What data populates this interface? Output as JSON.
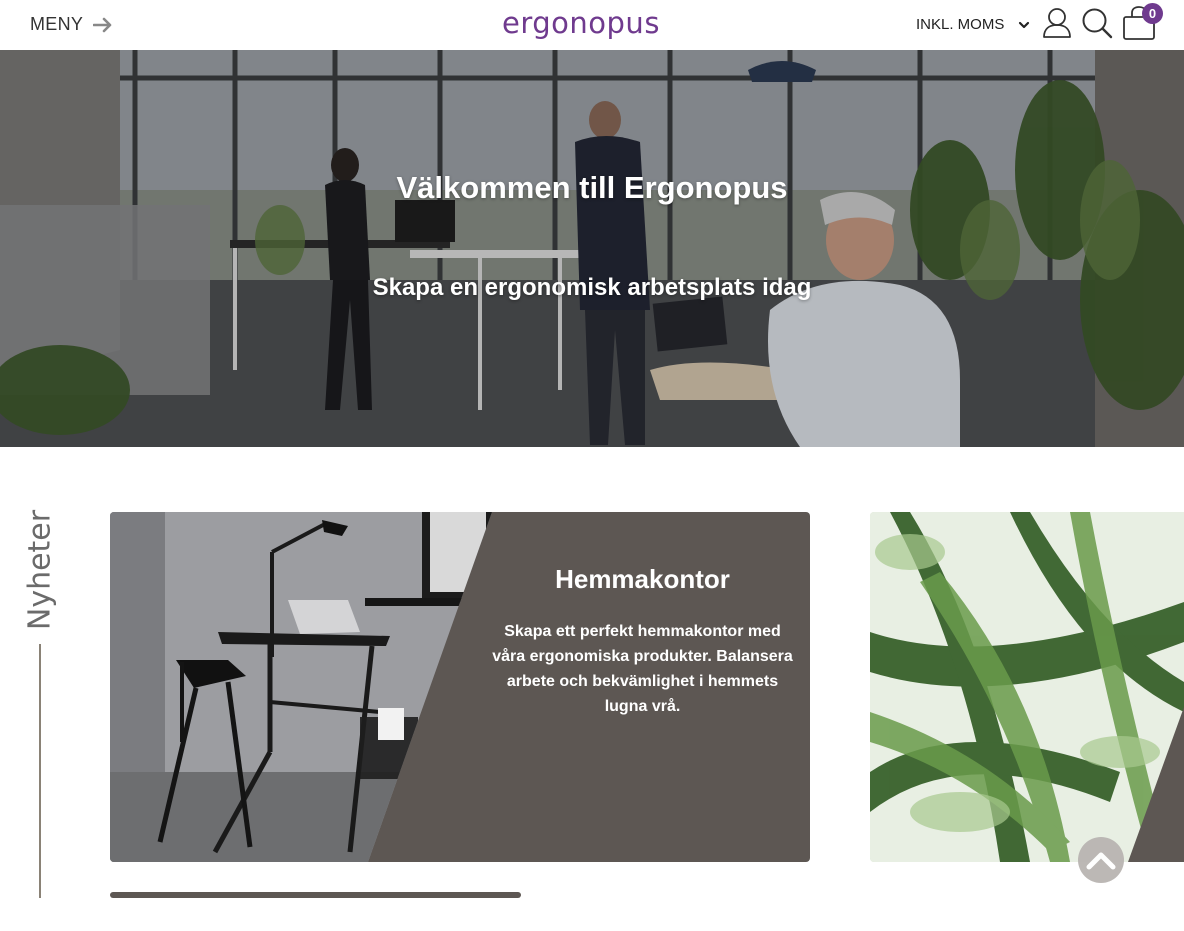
{
  "header": {
    "menu_label": "MENY",
    "logo_text": "ergonopus",
    "vat_label": "INKL. MOMS",
    "cart_count": "0"
  },
  "hero": {
    "title": "Välkommen till Ergonopus",
    "subtitle": "Skapa en ergonomisk arbetsplats idag"
  },
  "news": {
    "label": "Nyheter",
    "cards": [
      {
        "title": "Hemmakontor",
        "text": "Skapa ett perfekt hemmakontor med våra ergonomiska produkter. Balansera arbete och bekvämlighet i hemmets lugna vrå."
      }
    ],
    "scroll_progress": 0.38
  },
  "colors": {
    "brand": "#6f3a8e",
    "card_bg": "#5d5753",
    "accent_line": "#8a8276"
  },
  "icons": [
    "arrow-right-icon",
    "chevron-down-icon",
    "user-icon",
    "search-icon",
    "cart-icon",
    "chevron-up-icon"
  ]
}
